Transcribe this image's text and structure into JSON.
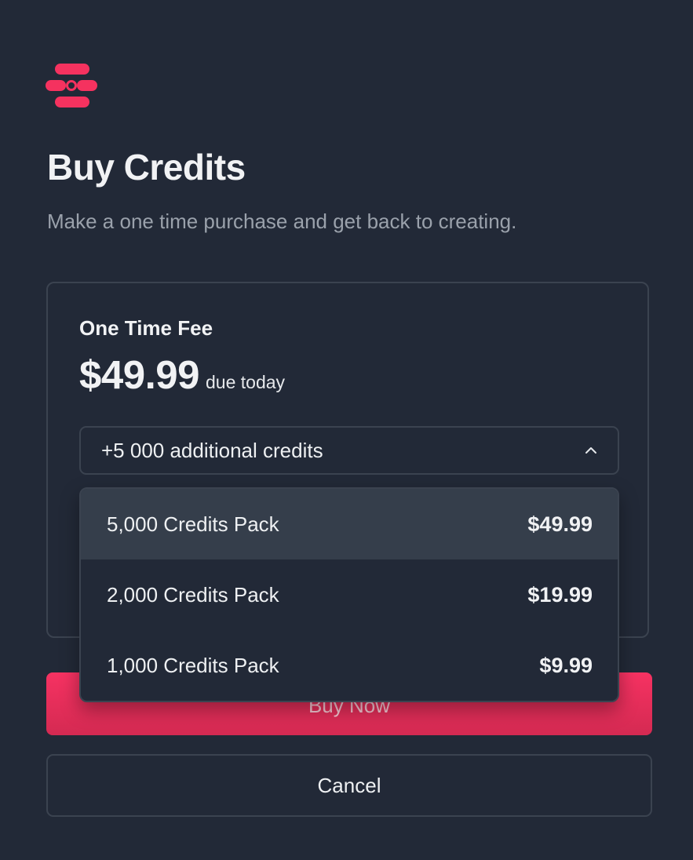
{
  "header": {
    "logo_icon": "brand-logo-icon",
    "title": "Buy Credits",
    "subtitle": "Make a one time purchase and get back to creating."
  },
  "plan": {
    "label": "One Time Fee",
    "price": "$49.99",
    "price_suffix": "due today"
  },
  "select": {
    "value": "+5 000 additional credits",
    "icon": "chevron-up-icon",
    "options": [
      {
        "name": "5,000 Credits Pack",
        "price": "$49.99",
        "active": true
      },
      {
        "name": "2,000 Credits Pack",
        "price": "$19.99",
        "active": false
      },
      {
        "name": "1,000 Credits Pack",
        "price": "$9.99",
        "active": false
      }
    ]
  },
  "actions": {
    "buy_label": "Buy Now",
    "cancel_label": "Cancel"
  },
  "colors": {
    "background": "#222937",
    "accent": "#f63262",
    "border": "#3b4350",
    "highlight": "#353e4b"
  }
}
